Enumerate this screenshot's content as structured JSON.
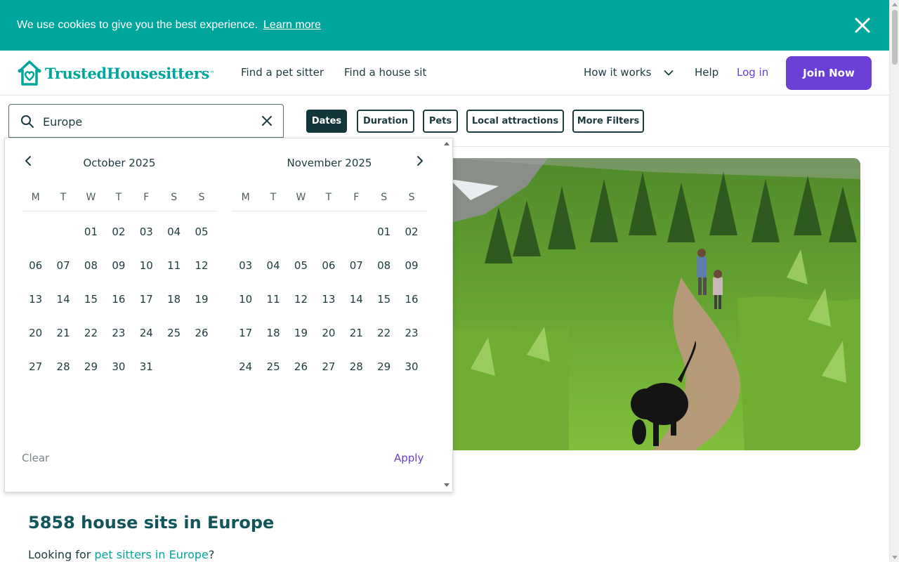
{
  "cookie_banner": {
    "message": "We use cookies to give you the best experience.",
    "link_label": "Learn more"
  },
  "header": {
    "logo_text": "TrustedHousesitters",
    "logo_tm": "™",
    "nav": {
      "find_pet_sitter": "Find a pet sitter",
      "find_house_sit": "Find a house sit",
      "how_it_works": "How it works",
      "help": "Help",
      "login": "Log in",
      "join": "Join Now"
    }
  },
  "search": {
    "value": "Europe",
    "placeholder": ""
  },
  "filters": {
    "dates": "Dates",
    "duration": "Duration",
    "pets": "Pets",
    "local_attractions": "Local attractions",
    "more_filters": "More Filters"
  },
  "calendar": {
    "weekdays": [
      "M",
      "T",
      "W",
      "T",
      "F",
      "S",
      "S"
    ],
    "months": [
      {
        "title": "October 2025",
        "weeks": [
          [
            "",
            "",
            "01",
            "02",
            "03",
            "04",
            "05"
          ],
          [
            "06",
            "07",
            "08",
            "09",
            "10",
            "11",
            "12"
          ],
          [
            "13",
            "14",
            "15",
            "16",
            "17",
            "18",
            "19"
          ],
          [
            "20",
            "21",
            "22",
            "23",
            "24",
            "25",
            "26"
          ],
          [
            "27",
            "28",
            "29",
            "30",
            "31",
            "",
            ""
          ]
        ]
      },
      {
        "title": "November 2025",
        "weeks": [
          [
            "",
            "",
            "",
            "",
            "",
            "01",
            "02"
          ],
          [
            "03",
            "04",
            "05",
            "06",
            "07",
            "08",
            "09"
          ],
          [
            "10",
            "11",
            "12",
            "13",
            "14",
            "15",
            "16"
          ],
          [
            "17",
            "18",
            "19",
            "20",
            "21",
            "22",
            "23"
          ],
          [
            "24",
            "25",
            "26",
            "27",
            "28",
            "29",
            "30"
          ]
        ]
      }
    ],
    "clear_label": "Clear",
    "apply_label": "Apply"
  },
  "results": {
    "title": "5858 house sits in Europe",
    "sub_prefix": "Looking for ",
    "sub_link": "pet sitters in Europe",
    "sub_suffix": "?"
  },
  "colors": {
    "brand_teal": "#00a69c",
    "brand_purple": "#6b3fd4",
    "dark_text": "#1d3b3f"
  }
}
